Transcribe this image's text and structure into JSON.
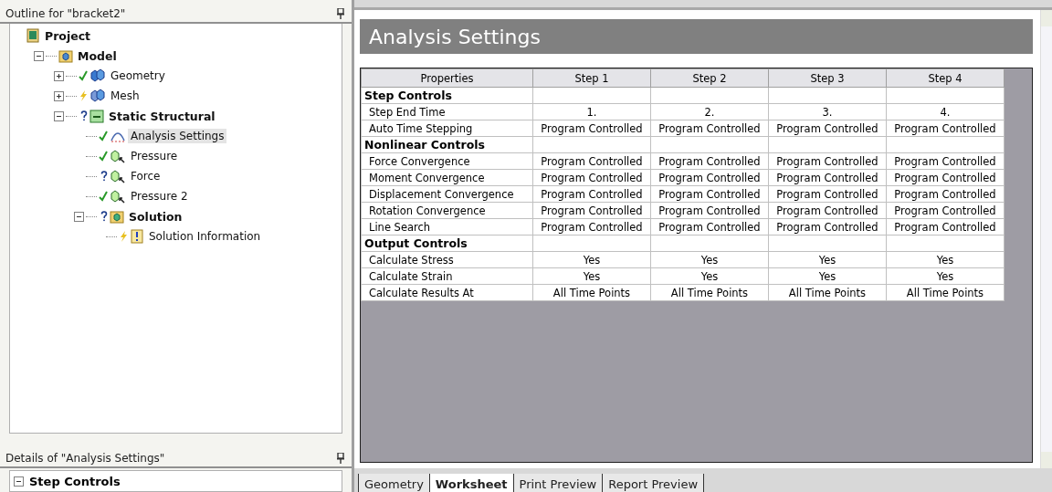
{
  "outline": {
    "title": "Outline for \"bracket2\"",
    "tree": [
      {
        "label": "Project",
        "kind": "project",
        "bold": true,
        "selected": false,
        "children": [
          {
            "label": "Model",
            "kind": "model",
            "bold": true,
            "selected": false,
            "expanded": true,
            "children": [
              {
                "label": "Geometry",
                "kind": "geometry",
                "up_to_date": true,
                "underdefined": false,
                "bold": false,
                "selected": false,
                "expanded": false
              },
              {
                "label": "Mesh",
                "kind": "mesh",
                "up_to_date": false,
                "underdefined": false,
                "bold": false,
                "selected": false,
                "expanded": false
              },
              {
                "label": "Static Structural",
                "kind": "analysis",
                "underdefined": true,
                "bold": true,
                "selected": false,
                "expanded": true,
                "children": [
                  {
                    "label": "Analysis Settings",
                    "kind": "settings",
                    "up_to_date": true,
                    "underdefined": false,
                    "bold": false,
                    "selected": true
                  },
                  {
                    "label": "Pressure",
                    "kind": "load",
                    "up_to_date": true,
                    "underdefined": false,
                    "bold": false,
                    "selected": false
                  },
                  {
                    "label": "Force",
                    "kind": "load",
                    "underdefined": true,
                    "bold": false,
                    "selected": false
                  },
                  {
                    "label": "Pressure 2",
                    "kind": "load",
                    "up_to_date": true,
                    "underdefined": false,
                    "bold": false,
                    "selected": false
                  },
                  {
                    "label": "Solution",
                    "kind": "solution",
                    "underdefined": true,
                    "bold": true,
                    "selected": false,
                    "expanded": true,
                    "children": [
                      {
                        "label": "Solution Information",
                        "kind": "info",
                        "up_to_date": false,
                        "underdefined": false,
                        "bold": false,
                        "selected": false
                      }
                    ]
                  }
                ]
              }
            ]
          }
        ]
      }
    ]
  },
  "details": {
    "title": "Details of \"Analysis Settings\"",
    "section": "Step Controls",
    "expanded": true
  },
  "worksheet": {
    "title": "Analysis Settings",
    "columns": [
      "Properties",
      "Step 1",
      "Step 2",
      "Step 3",
      "Step 4"
    ],
    "rows": [
      {
        "kind": "section",
        "label": "Step Controls"
      },
      {
        "kind": "row",
        "label": "Step End Time",
        "cells": [
          "1.",
          "2.",
          "3.",
          "4."
        ]
      },
      {
        "kind": "row",
        "label": "Auto Time Stepping",
        "cells": [
          "Program Controlled",
          "Program Controlled",
          "Program Controlled",
          "Program Controlled"
        ]
      },
      {
        "kind": "section",
        "label": "Nonlinear Controls"
      },
      {
        "kind": "row",
        "label": "Force Convergence",
        "cells": [
          "Program Controlled",
          "Program Controlled",
          "Program Controlled",
          "Program Controlled"
        ]
      },
      {
        "kind": "row",
        "label": "Moment Convergence",
        "cells": [
          "Program Controlled",
          "Program Controlled",
          "Program Controlled",
          "Program Controlled"
        ]
      },
      {
        "kind": "row",
        "label": "Displacement Convergence",
        "cells": [
          "Program Controlled",
          "Program Controlled",
          "Program Controlled",
          "Program Controlled"
        ]
      },
      {
        "kind": "row",
        "label": "Rotation Convergence",
        "cells": [
          "Program Controlled",
          "Program Controlled",
          "Program Controlled",
          "Program Controlled"
        ]
      },
      {
        "kind": "row",
        "label": "Line Search",
        "cells": [
          "Program Controlled",
          "Program Controlled",
          "Program Controlled",
          "Program Controlled"
        ]
      },
      {
        "kind": "section",
        "label": "Output Controls"
      },
      {
        "kind": "row",
        "label": "Calculate Stress",
        "cells": [
          "Yes",
          "Yes",
          "Yes",
          "Yes"
        ]
      },
      {
        "kind": "row",
        "label": "Calculate Strain",
        "cells": [
          "Yes",
          "Yes",
          "Yes",
          "Yes"
        ]
      },
      {
        "kind": "row",
        "label": "Calculate Results At",
        "cells": [
          "All Time Points",
          "All Time Points",
          "All Time Points",
          "All Time Points"
        ]
      }
    ]
  },
  "tabs": [
    {
      "label": "Geometry",
      "selected": false
    },
    {
      "label": "Worksheet",
      "selected": true
    },
    {
      "label": "Print Preview",
      "selected": false
    },
    {
      "label": "Report Preview",
      "selected": false
    }
  ]
}
